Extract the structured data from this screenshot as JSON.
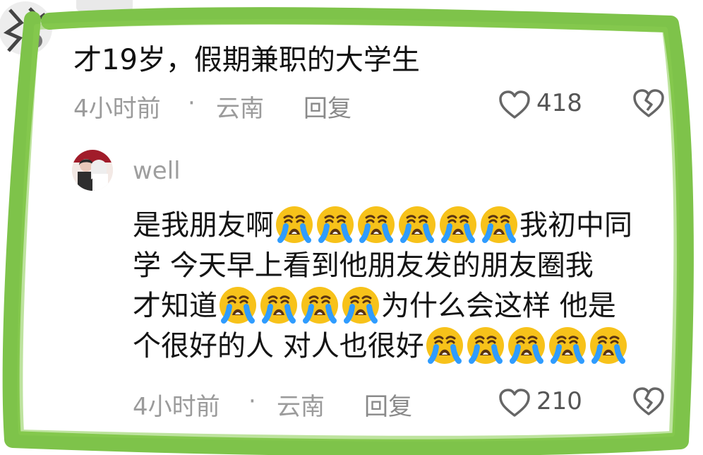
{
  "comment": {
    "text": "才19岁，假期兼职的大学生",
    "time": "4小时前",
    "separator": "·",
    "location": "云南",
    "reply_label": "回复",
    "likes": "418"
  },
  "reply": {
    "username": "well",
    "lines": [
      {
        "parts": [
          "是我朋友啊",
          "我初中同"
        ]
      },
      {
        "parts": [
          "学 今天早上看到他朋友发的朋友圈我"
        ]
      },
      {
        "parts": [
          "才知道",
          "为什么会这样 他是"
        ]
      },
      {
        "parts": [
          "个很好的人 对人也很好"
        ]
      }
    ],
    "time": "4小时前",
    "separator": "·",
    "location": "云南",
    "reply_label": "回复",
    "likes": "210"
  },
  "icons": {
    "like": "heart-outline-icon",
    "dislike": "broken-heart-icon",
    "emoji": "loudly-crying-face"
  },
  "colors": {
    "frame": "#7ec34a",
    "text": "#111111",
    "meta": "#9b9b9b",
    "emoji_face": "#f7c21a"
  }
}
